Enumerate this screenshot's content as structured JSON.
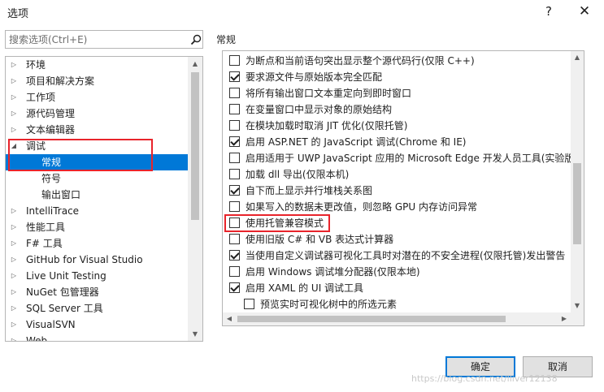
{
  "window": {
    "title": "选项",
    "help_label": "?",
    "close_label": "✕"
  },
  "search": {
    "placeholder": "搜索选项(Ctrl+E)"
  },
  "tree": {
    "items": [
      {
        "label": "环境",
        "arrow": "▷"
      },
      {
        "label": "项目和解决方案",
        "arrow": "▷"
      },
      {
        "label": "工作项",
        "arrow": "▷"
      },
      {
        "label": "源代码管理",
        "arrow": "▷"
      },
      {
        "label": "文本编辑器",
        "arrow": "▷"
      },
      {
        "label": "调试",
        "arrow": "◢"
      },
      {
        "label": "常规",
        "arrow": "",
        "selected": true
      },
      {
        "label": "符号",
        "arrow": ""
      },
      {
        "label": "输出窗口",
        "arrow": ""
      },
      {
        "label": "IntelliTrace",
        "arrow": "▷"
      },
      {
        "label": "性能工具",
        "arrow": "▷"
      },
      {
        "label": "F# 工具",
        "arrow": "▷"
      },
      {
        "label": "GitHub for Visual Studio",
        "arrow": "▷"
      },
      {
        "label": "Live Unit Testing",
        "arrow": "▷"
      },
      {
        "label": "NuGet 包管理器",
        "arrow": "▷"
      },
      {
        "label": "SQL Server 工具",
        "arrow": "▷"
      },
      {
        "label": "VisualSVN",
        "arrow": "▷"
      },
      {
        "label": "Web",
        "arrow": "▷"
      }
    ]
  },
  "section": {
    "title": "常规"
  },
  "options": [
    {
      "label": "为断点和当前语句突出显示整个源代码行(仅限 C++)",
      "checked": false
    },
    {
      "label": "要求源文件与原始版本完全匹配",
      "checked": true
    },
    {
      "label": "将所有输出窗口文本重定向到即时窗口",
      "checked": false
    },
    {
      "label": "在变量窗口中显示对象的原始结构",
      "checked": false
    },
    {
      "label": "在模块加载时取消 JIT 优化(仅限托管)",
      "checked": false
    },
    {
      "label": "启用 ASP.NET 的 JavaScript 调试(Chrome 和 IE)",
      "checked": true
    },
    {
      "label": "启用适用于 UWP JavaScript 应用的 Microsoft Edge 开发人员工具(实验版",
      "checked": false
    },
    {
      "label": "加载 dll 导出(仅限本机)",
      "checked": false
    },
    {
      "label": "自下而上显示并行堆栈关系图",
      "checked": true
    },
    {
      "label": "如果写入的数据未更改值，则忽略 GPU 内存访问异常",
      "checked": false
    },
    {
      "label": "使用托管兼容模式",
      "checked": false
    },
    {
      "label": "使用旧版 C# 和 VB 表达式计算器",
      "checked": false
    },
    {
      "label": "当使用自定义调试器可视化工具时对潜在的不安全进程(仅限托管)发出警告",
      "checked": true
    },
    {
      "label": "启用 Windows 调试堆分配器(仅限本地)",
      "checked": false
    },
    {
      "label": "启用 XAML 的 UI 调试工具",
      "checked": true
    },
    {
      "label": "预览实时可视化树中的所选元素",
      "checked": false,
      "indent": true
    }
  ],
  "buttons": {
    "ok_label": "确定",
    "cancel_label": "取消"
  },
  "watermark": "https://blog.csdn.net/lliver12138",
  "colors": {
    "selection": "#0078d7",
    "annotation_red": "#e8242b",
    "border": "#b5b5b5",
    "button_bg": "#e1e1e1"
  }
}
